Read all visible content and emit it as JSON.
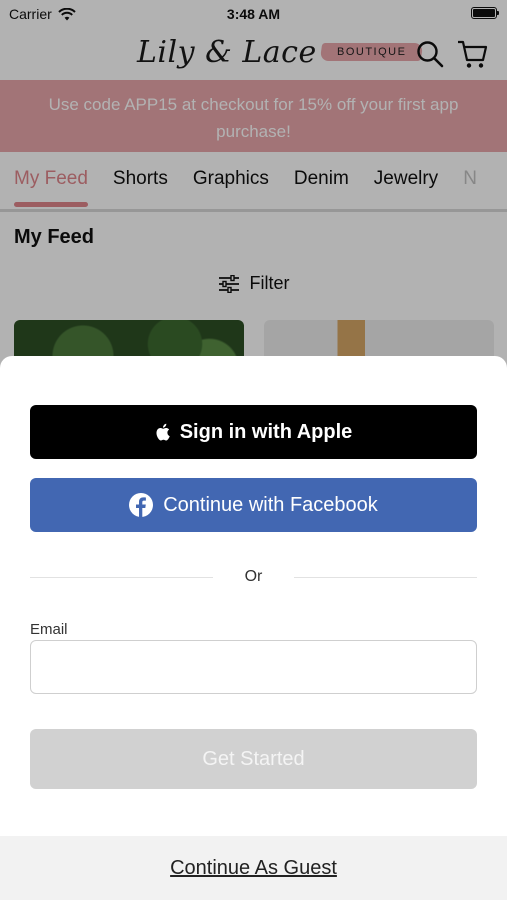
{
  "status_bar": {
    "carrier": "Carrier",
    "time": "3:48 AM"
  },
  "header": {
    "logo_script": "Lily & Lace",
    "logo_badge": "BOUTIQUE"
  },
  "promo": {
    "text": "Use code APP15 at checkout for 15% off your first app purchase!"
  },
  "tabs": [
    {
      "label": "My Feed",
      "active": true
    },
    {
      "label": "Shorts"
    },
    {
      "label": "Graphics"
    },
    {
      "label": "Denim"
    },
    {
      "label": "Jewelry"
    },
    {
      "label": "N"
    }
  ],
  "feed": {
    "title": "My Feed",
    "filter_label": "Filter"
  },
  "sheet": {
    "apple_label": "Sign in with Apple",
    "facebook_label": "Continue with Facebook",
    "divider_text": "Or",
    "email_label": "Email",
    "email_value": "",
    "email_placeholder": "",
    "get_started_label": "Get Started",
    "guest_label": "Continue As Guest"
  },
  "colors": {
    "brand_pink": "#e8a6ab",
    "facebook_blue": "#4267b2",
    "disabled_gray": "#d1d1d1"
  },
  "icons": [
    "wifi-icon",
    "battery-icon",
    "search-icon",
    "cart-icon",
    "filter-icon",
    "apple-icon",
    "facebook-icon"
  ]
}
